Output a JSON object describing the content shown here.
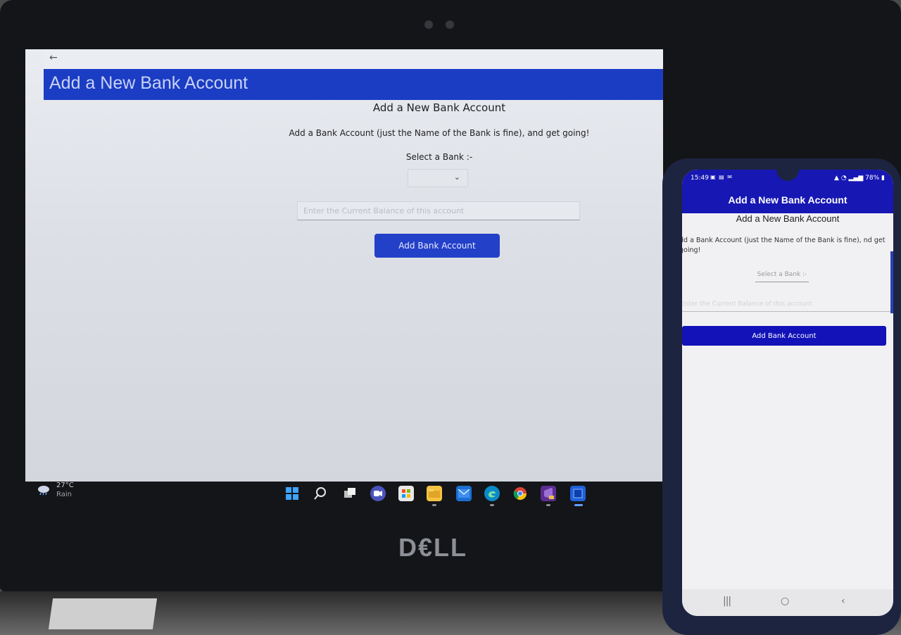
{
  "desktop": {
    "window": {
      "back_glyph": "←",
      "controls": "– ▢ ✕"
    },
    "app_header_title": "Add a New Bank Account",
    "form": {
      "heading": "Add a New Bank Account",
      "subtext": "Add a Bank Account (just the Name of the Bank is fine), and get going!",
      "select_label": "Select a Bank :-",
      "select_value": "",
      "balance_placeholder": "Enter the Current Balance of this account",
      "balance_value": "",
      "submit_label": "Add Bank Account"
    },
    "taskbar": {
      "weather_temp": "27°C",
      "weather_condition": "Rain",
      "pinned_icons": [
        "start-icon",
        "search-icon",
        "task-view-icon",
        "teams-chat-icon",
        "store-icon",
        "file-explorer-icon",
        "mail-icon",
        "edge-icon",
        "chrome-icon",
        "visual-studio-icon",
        "running-app-icon"
      ]
    },
    "brand": "D€LL"
  },
  "phone": {
    "status": {
      "time": "15:49",
      "left_icons": "▣ ▤ ✉",
      "battery": "78%"
    },
    "app_header_title": "Add a New Bank Account",
    "form": {
      "heading": "Add a New Bank Account",
      "subtext": "dd a Bank Account (just the Name of the Bank is fine), nd get going!",
      "select_placeholder": "Select a Bank :-",
      "balance_placeholder": "Enter the Current Balance of this account",
      "submit_label": "Add Bank Account"
    },
    "nav": {
      "recents": "|||",
      "home": "○",
      "back": "‹"
    }
  },
  "colors": {
    "desktop_header": "#1b3dc4",
    "desktop_button": "#2340c9",
    "phone_header": "#1717b4",
    "phone_button": "#1212b8"
  }
}
